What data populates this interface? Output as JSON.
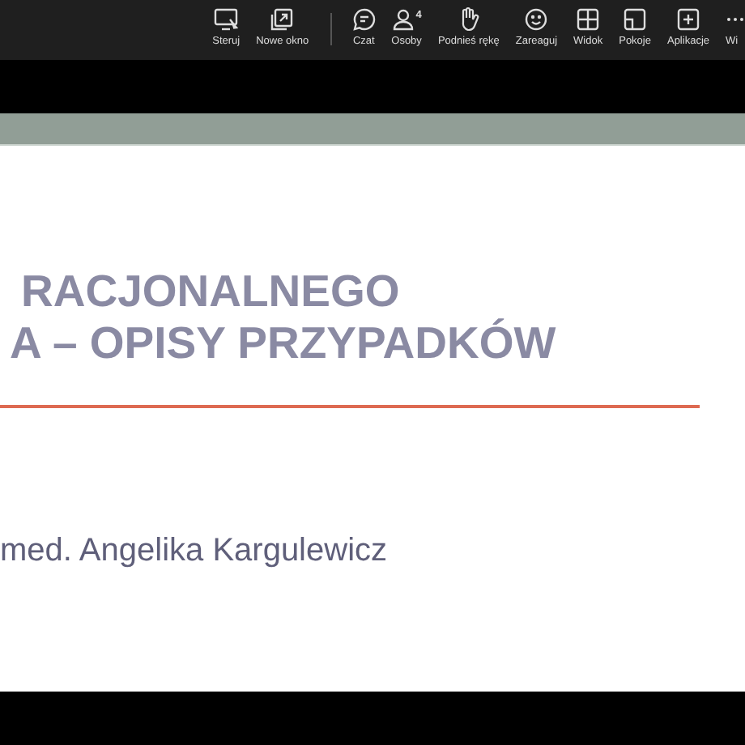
{
  "toolbar": {
    "items": [
      {
        "kind": "share",
        "label": "Steruj"
      },
      {
        "kind": "popout",
        "label": "Nowe okno"
      },
      {
        "kind": "divider"
      },
      {
        "kind": "chat",
        "label": "Czat"
      },
      {
        "kind": "people",
        "label": "Osoby",
        "badge": "4"
      },
      {
        "kind": "hand",
        "label": "Podnieś rękę"
      },
      {
        "kind": "react",
        "label": "Zareaguj"
      },
      {
        "kind": "view",
        "label": "Widok"
      },
      {
        "kind": "rooms",
        "label": "Pokoje"
      },
      {
        "kind": "apps",
        "label": "Aplikacje"
      },
      {
        "kind": "more",
        "label": "Wi"
      }
    ]
  },
  "slide": {
    "title_lines": [
      "RACJONALNEGO",
      "A – OPISY PRZYPADKÓW"
    ],
    "author": "med. Angelika Kargulewicz"
  }
}
